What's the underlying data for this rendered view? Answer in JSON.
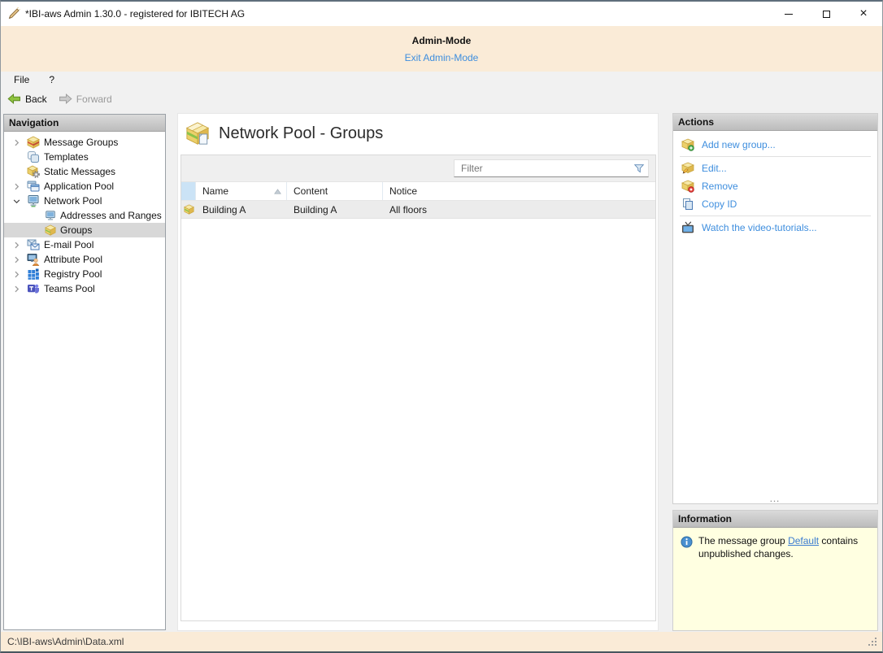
{
  "window": {
    "title": "*IBI-aws Admin 1.30.0 - registered for IBITECH AG",
    "controls": [
      {
        "name": "minimize-button",
        "icon": "minimize-icon"
      },
      {
        "name": "maximize-button",
        "icon": "maximize-icon"
      },
      {
        "name": "close-button",
        "icon": "close-icon"
      }
    ]
  },
  "banner": {
    "title": "Admin-Mode",
    "exit_link": "Exit Admin-Mode"
  },
  "menubar": {
    "items": [
      "File",
      "?"
    ]
  },
  "toolbar": {
    "back_label": "Back",
    "forward_label": "Forward",
    "back_icon": "back-arrow-icon",
    "forward_icon": "forward-arrow-icon",
    "forward_disabled": true
  },
  "navigation": {
    "header": "Navigation",
    "items": [
      {
        "label": "Message Groups",
        "icon": "message-groups-icon",
        "level": 0,
        "state": "collapsed"
      },
      {
        "label": "Templates",
        "icon": "templates-icon",
        "level": 0,
        "state": "leaf"
      },
      {
        "label": "Static Messages",
        "icon": "static-messages-icon",
        "level": 0,
        "state": "leaf"
      },
      {
        "label": "Application Pool",
        "icon": "application-pool-icon",
        "level": 0,
        "state": "collapsed"
      },
      {
        "label": "Network Pool",
        "icon": "network-pool-icon",
        "level": 0,
        "state": "expanded"
      },
      {
        "label": "Addresses and Ranges",
        "icon": "addresses-ranges-icon",
        "level": 1,
        "state": "leaf"
      },
      {
        "label": "Groups",
        "icon": "groups-icon",
        "level": 1,
        "state": "leaf",
        "selected": true
      },
      {
        "label": "E-mail Pool",
        "icon": "email-pool-icon",
        "level": 0,
        "state": "collapsed"
      },
      {
        "label": "Attribute Pool",
        "icon": "attribute-pool-icon",
        "level": 0,
        "state": "collapsed"
      },
      {
        "label": "Registry Pool",
        "icon": "registry-pool-icon",
        "level": 0,
        "state": "collapsed"
      },
      {
        "label": "Teams Pool",
        "icon": "teams-pool-icon",
        "level": 0,
        "state": "collapsed"
      }
    ]
  },
  "main": {
    "title": "Network Pool - Groups",
    "title_icon": "network-group-icon",
    "filter": {
      "placeholder": "Filter",
      "icon": "filter-funnel-icon"
    },
    "table": {
      "columns": [
        "Name",
        "Content",
        "Notice"
      ],
      "sort": {
        "column": "Name",
        "direction": "ascending"
      },
      "rows": [
        {
          "icon": "group-box-icon",
          "name": "Building A",
          "content": "Building A",
          "notice": "All floors"
        }
      ]
    }
  },
  "actions": {
    "header": "Actions",
    "items": [
      {
        "label": "Add new group...",
        "icon": "add-group-icon"
      },
      {
        "label": "Edit...",
        "icon": "edit-group-icon"
      },
      {
        "label": "Remove",
        "icon": "remove-group-icon"
      },
      {
        "label": "Copy ID",
        "icon": "copy-id-icon"
      },
      {
        "label": "Watch the video-tutorials...",
        "icon": "video-tutorials-icon"
      }
    ]
  },
  "information": {
    "header": "Information",
    "icon": "info-icon",
    "message_prefix": "The message group ",
    "message_link": "Default",
    "message_suffix": " contains unpublished changes."
  },
  "statusbar": {
    "path": "C:\\IBI-aws\\Admin\\Data.xml"
  },
  "colors": {
    "banner_bg": "#faebd7",
    "link_blue": "#3e8ede",
    "info_bg": "#ffffe1",
    "selection_gray": "#d8d8d8",
    "table_icon_header_bg": "#cbe3f6",
    "panel_header_gradient_top": "#dadada",
    "panel_header_gradient_bottom": "#bcbcbc"
  }
}
